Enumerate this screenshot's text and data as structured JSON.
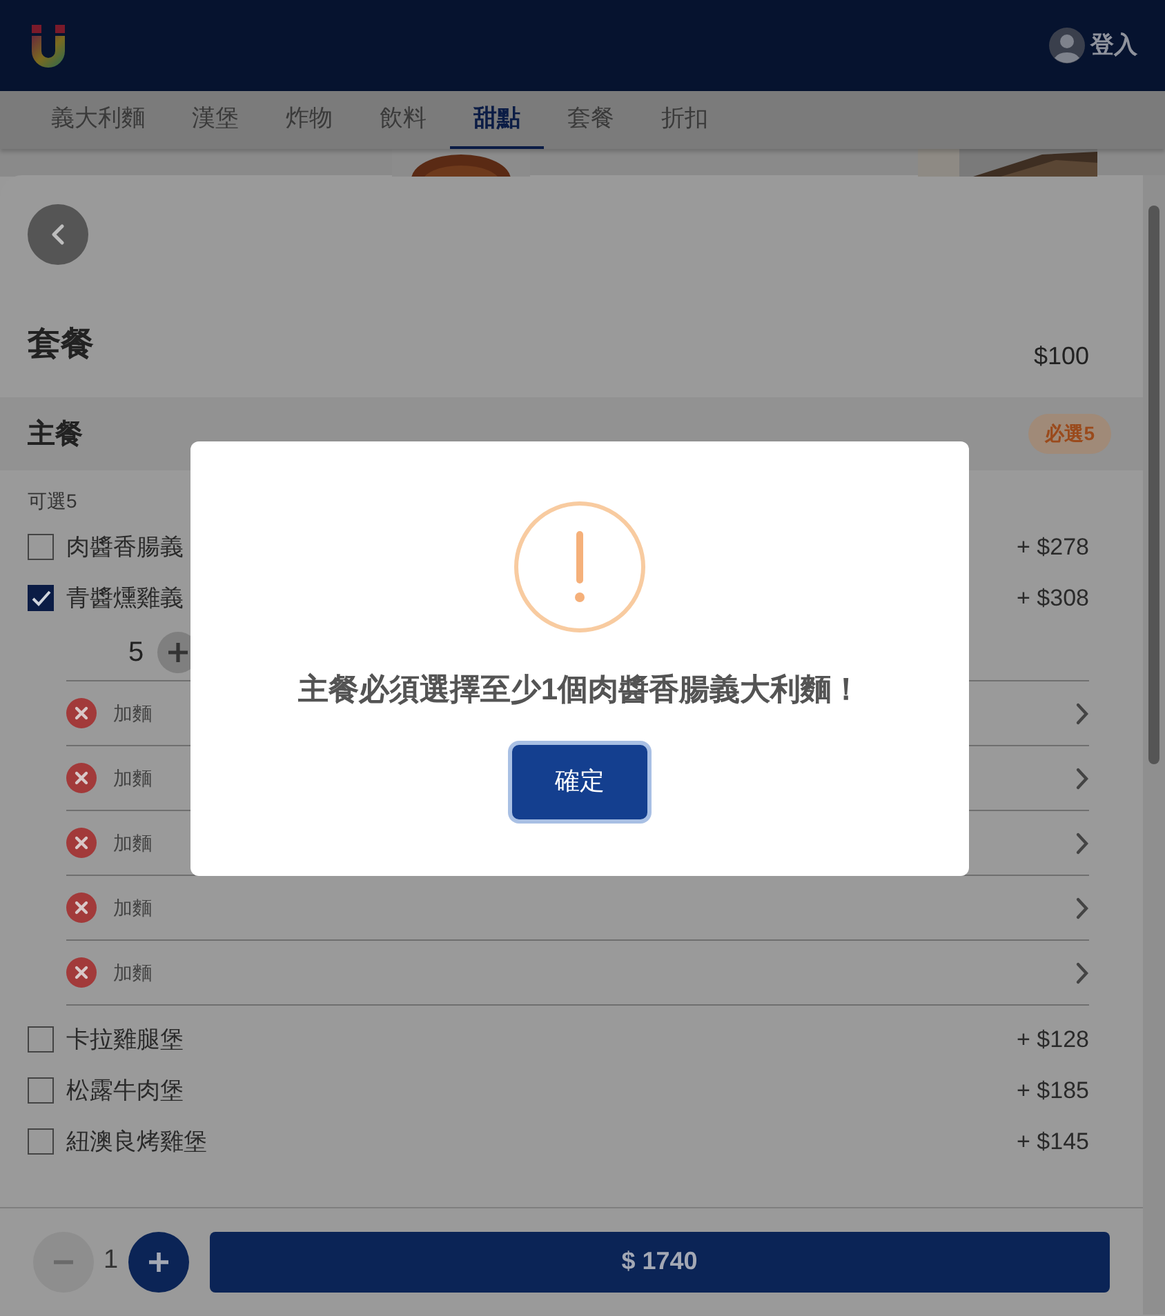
{
  "header": {
    "login_label": "登入"
  },
  "tabs": [
    {
      "label": "義大利麵",
      "selected": false
    },
    {
      "label": "漢堡",
      "selected": false
    },
    {
      "label": "炸物",
      "selected": false
    },
    {
      "label": "飲料",
      "selected": false
    },
    {
      "label": "甜點",
      "selected": true
    },
    {
      "label": "套餐",
      "selected": false
    },
    {
      "label": "折扣",
      "selected": false
    }
  ],
  "sheet": {
    "title": "套餐",
    "price": "$100",
    "section": {
      "title": "主餐",
      "badge": "必選5",
      "hint": "可選5",
      "options": [
        {
          "name": "肉醬香腸義",
          "price": "+ $278",
          "checked": false
        },
        {
          "name": "青醬燻雞義",
          "price": "+ $308",
          "checked": true,
          "quantity": "5",
          "addons": [
            {
              "label": "加麵"
            },
            {
              "label": "加麵"
            },
            {
              "label": "加麵"
            },
            {
              "label": "加麵"
            },
            {
              "label": "加麵"
            }
          ]
        },
        {
          "name": "卡拉雞腿堡",
          "price": "+ $128",
          "checked": false
        },
        {
          "name": "松露牛肉堡",
          "price": "+ $185",
          "checked": false
        },
        {
          "name": "紐澳良烤雞堡",
          "price": "+ $145",
          "checked": false
        }
      ]
    }
  },
  "footer": {
    "quantity": "1",
    "total": "$ 1740"
  },
  "dialog": {
    "message": "主餐必須選擇至少1個肉醬香腸義大利麵！",
    "confirm": "確定"
  }
}
